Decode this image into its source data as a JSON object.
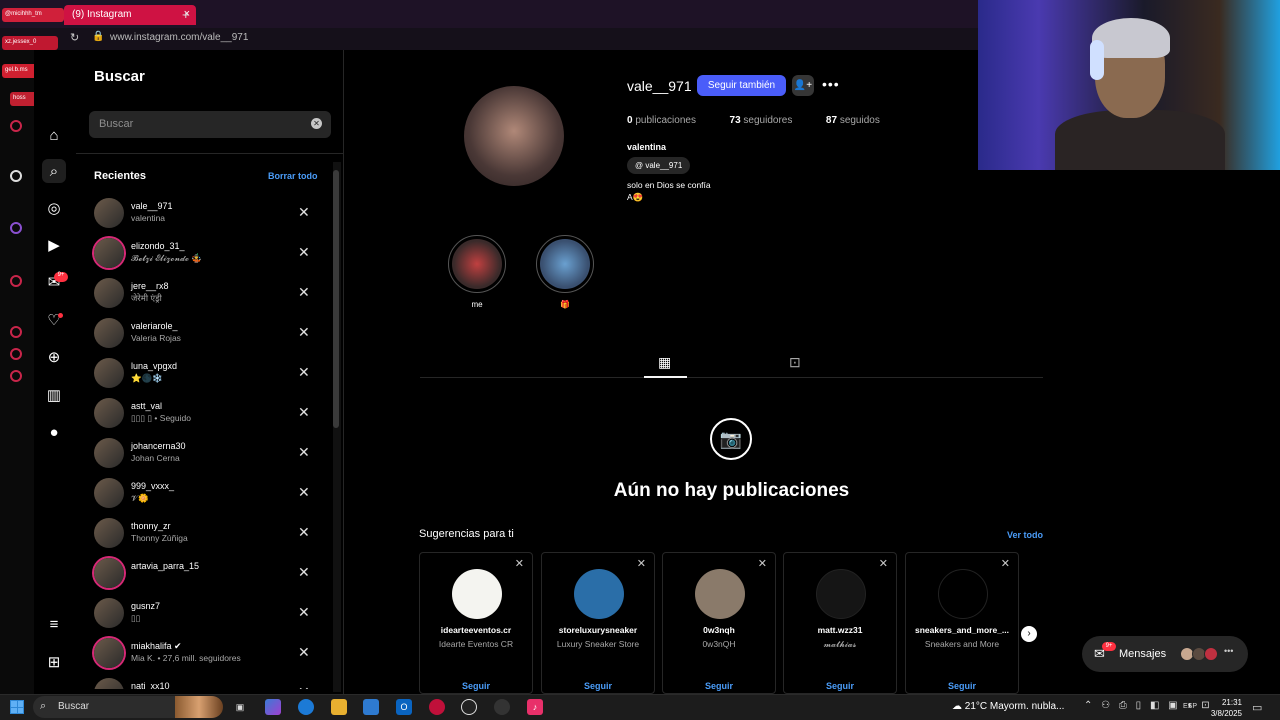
{
  "browser": {
    "tab_title": "(9) Instagram",
    "tab_close": "×",
    "new_tab": "+",
    "url": "www.instagram.com/vale__971"
  },
  "overlay_chat": [
    {
      "text": "@micihhh_tm",
      "color": "#d0203a"
    },
    {
      "text": "xz.jessex_0",
      "color": "#c01830"
    },
    {
      "text": "gel.b.ms",
      "color": "#d02030"
    },
    {
      "text": "hoss",
      "color": "#c02030"
    }
  ],
  "search_panel": {
    "title": "Buscar",
    "search_placeholder": "Buscar",
    "recent_heading": "Recientes",
    "clear_all": "Borrar todo",
    "recent": [
      {
        "username": "vale__971",
        "subtitle": "valentina",
        "ring": false
      },
      {
        "username": "elizondo_31_",
        "subtitle": "𝓑𝓮𝓽𝔃𝓲 𝓔𝓵𝓲𝔃𝓸𝓷𝓭𝓸 🤹",
        "ring": true
      },
      {
        "username": "jere__rx8",
        "subtitle": "जेरेमी एंड्री",
        "ring": false
      },
      {
        "username": "valeriarole_",
        "subtitle": "Valeria Rojas",
        "ring": false
      },
      {
        "username": "luna_vpgxd",
        "subtitle": "⭐🌑❄️",
        "ring": false
      },
      {
        "username": "astt_val",
        "subtitle": "▯▯▯ ▯ • Seguido",
        "ring": false
      },
      {
        "username": "johancerna30",
        "subtitle": "Johan Cerna",
        "ring": false
      },
      {
        "username": "999_vxxx_",
        "subtitle": "𝓥🌼",
        "ring": false
      },
      {
        "username": "thonny_zr",
        "subtitle": "Thonny Zúñiga",
        "ring": false
      },
      {
        "username": "artavia_parra_15",
        "subtitle": "",
        "ring": true
      },
      {
        "username": "gusnz7",
        "subtitle": "▯▯",
        "ring": false
      },
      {
        "username": "miakhalifa ✔",
        "subtitle": "Mia K. • 27,6 mill. seguidores",
        "ring": true
      },
      {
        "username": "nati_xx10",
        "subtitle": "",
        "ring": false
      }
    ],
    "remove_icon": "✕"
  },
  "profile": {
    "username": "vale__971",
    "follow_button": "Seguir también",
    "suggest_icon": "👤+",
    "more_icon": "•••",
    "stats": {
      "posts_count": "0",
      "posts_label": "publicaciones",
      "followers_count": "73",
      "followers_label": "seguidores",
      "following_count": "87",
      "following_label": "seguidos"
    },
    "full_name": "valentina",
    "threads_handle": "vale__971",
    "bio_line1": "solo en Dios se confía",
    "bio_line2": "A😍",
    "highlights": [
      {
        "label": "me"
      },
      {
        "label": "🎁"
      }
    ],
    "empty_title": "Aún no hay publicaciones",
    "tab_posts_icon": "▦",
    "tab_tagged_icon": "⊡",
    "camera_icon": "📷"
  },
  "suggestions": {
    "heading": "Sugerencias para ti",
    "see_all": "Ver todo",
    "follow_label": "Seguir",
    "close_icon": "✕",
    "next_icon": "›",
    "cards": [
      {
        "username": "idearteeventos.cr",
        "subtitle": "Idearte Eventos CR",
        "avatar_color": "#f4f4f0"
      },
      {
        "username": "storeluxurysneaker",
        "subtitle": "Luxury Sneaker Store",
        "avatar_color": "#2a6ea8"
      },
      {
        "username": "0w3nqh",
        "subtitle": "0w3nQH",
        "avatar_color": "#8a7a6a"
      },
      {
        "username": "matt.wzz31",
        "subtitle": "𝓶𝓪𝓽𝓱𝓲𝓪𝓼",
        "avatar_color": "#151515"
      },
      {
        "username": "sneakers_and_more_...",
        "subtitle": "Sneakers and More",
        "avatar_color": "#000000"
      }
    ]
  },
  "messages": {
    "label": "Mensajes",
    "badge": "9+",
    "more": "•••"
  },
  "taskbar": {
    "search_label": "Buscar",
    "weather": "21°C  Mayorm. nubla...",
    "lang": "ESP",
    "time": "21:31",
    "date": "3/8/2025"
  },
  "colors": {
    "accent_blue": "#4a5df9",
    "link_blue": "#4a9cf8",
    "notification_red": "#ff3040",
    "tab_red": "#cf1243"
  }
}
